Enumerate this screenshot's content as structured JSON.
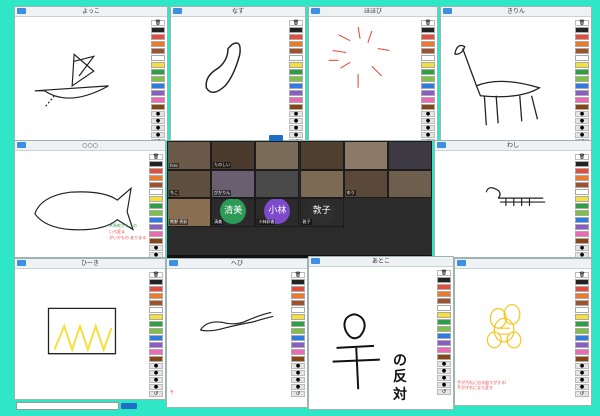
{
  "panels": [
    {
      "title": "よっこ"
    },
    {
      "title": "なす"
    },
    {
      "title": "ほほび"
    },
    {
      "title": "きりん"
    },
    {
      "title": "○○○"
    },
    {
      "title": "わし"
    },
    {
      "title": "ひーき"
    },
    {
      "title": "へび"
    },
    {
      "title": "あとこ"
    },
    {
      "title": ""
    }
  ],
  "palette_colors": [
    "#222222",
    "#e64b3c",
    "#e87b2e",
    "#a0522d",
    "#ffffff",
    "#f5e03a",
    "#2f9e44",
    "#7cc242",
    "#2f7be0",
    "#8a5cc8",
    "#e86bb3",
    "#8b4513"
  ],
  "video": {
    "tiles": [
      {
        "name": "hiro"
      },
      {
        "name": "たのしい"
      },
      {
        "name": ""
      },
      {
        "name": ""
      },
      {
        "name": ""
      },
      {
        "name": ""
      },
      {
        "name": "ちこ"
      },
      {
        "name": "ぴかりん"
      },
      {
        "name": ""
      },
      {
        "name": ""
      },
      {
        "name": "ゆう"
      },
      {
        "name": ""
      },
      {
        "name": "熊野 秀彩"
      },
      {
        "name": "清美",
        "avatar": "清美",
        "color": "#2e9a58"
      },
      {
        "name": "小林彩香",
        "avatar": "小林 彩香",
        "color": "#7d4bc9"
      },
      {
        "name": "敦子",
        "avatar": "敦子",
        "color": "#2f2f2f"
      }
    ]
  },
  "annotations": {
    "green_1": "木馬蛇からこの",
    "red_1": "いろ変ま",
    "red_2": "がいかもの ありまる",
    "red_3": "手がぎれになり変す",
    "red_4": "手が汚れに出る起りがする!",
    "bottom_left": "を"
  },
  "handwriting": {
    "char_1": "の",
    "char_2": "反",
    "char_3": "対"
  }
}
